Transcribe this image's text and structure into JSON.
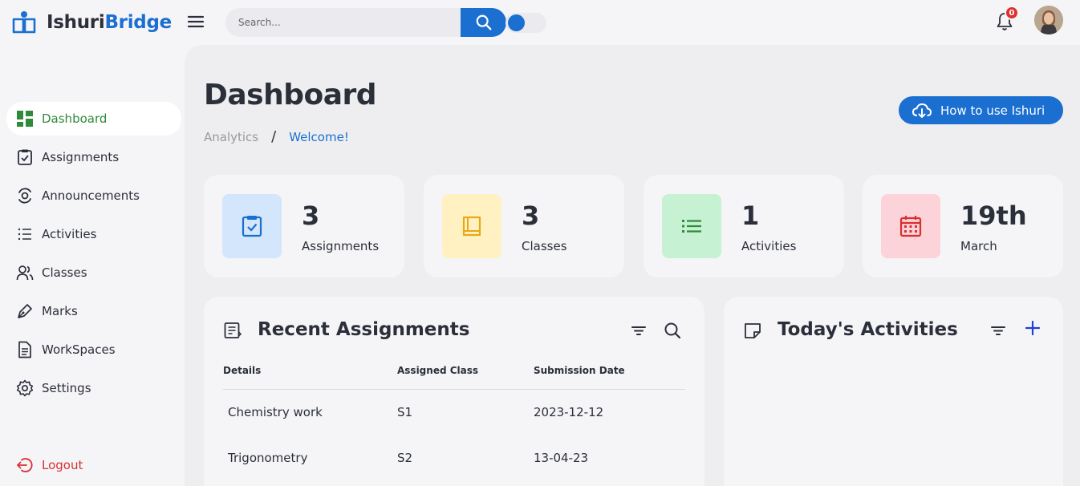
{
  "brand": {
    "name_part1": "Ishuri",
    "name_part2": "Bridge",
    "accent": "#1a6fd1"
  },
  "search": {
    "placeholder": "Search..."
  },
  "notifications": {
    "count": "0"
  },
  "sidebar": {
    "items": [
      {
        "label": "Dashboard",
        "icon": "grid-icon"
      },
      {
        "label": "Assignments",
        "icon": "clipboard-check-icon"
      },
      {
        "label": "Announcements",
        "icon": "broadcast-icon"
      },
      {
        "label": "Activities",
        "icon": "list-icon"
      },
      {
        "label": "Classes",
        "icon": "users-icon"
      },
      {
        "label": "Marks",
        "icon": "pen-icon"
      },
      {
        "label": "WorkSpaces",
        "icon": "document-icon"
      },
      {
        "label": "Settings",
        "icon": "gear-icon"
      }
    ],
    "logout": "Logout"
  },
  "page": {
    "title": "Dashboard",
    "breadcrumb": [
      "Analytics",
      "Welcome!"
    ],
    "help_button": "How to use Ishuri"
  },
  "stats": [
    {
      "value": "3",
      "label": "Assignments",
      "color": "#d4e6fb"
    },
    {
      "value": "3",
      "label": "Classes",
      "color": "#fff1c2"
    },
    {
      "value": "1",
      "label": "Activities",
      "color": "#c6f2d3"
    },
    {
      "value": "19th",
      "label": "March",
      "color": "#fcd3d8"
    }
  ],
  "recent_assignments": {
    "title": "Recent Assignments",
    "columns": [
      "Details",
      "Assigned Class",
      "Submission Date"
    ],
    "rows": [
      [
        "Chemistry work",
        "S1",
        "2023-12-12"
      ],
      [
        "Trigonometry",
        "S2",
        "13-04-23"
      ]
    ]
  },
  "todays_activities": {
    "title": "Today's Activities"
  }
}
